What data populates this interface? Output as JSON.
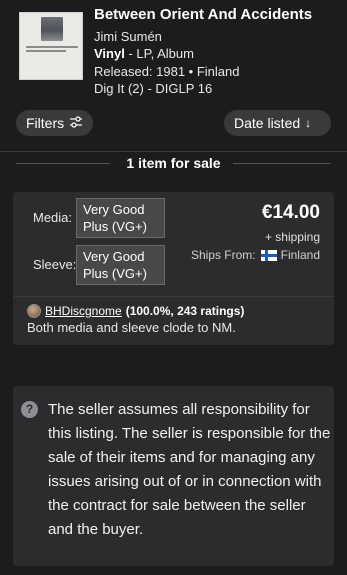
{
  "release": {
    "cover_text": "BETWEEN ORIENT AND ACCIDENTS",
    "title": "Between Orient And Accidents",
    "artist": "Jimi Sumén",
    "format_bold": "Vinyl",
    "format_rest": " - LP, Album",
    "released": "Released: 1981 • Finland",
    "label": "Dig It (2) - DIGLP 16"
  },
  "controls": {
    "filters_label": "Filters",
    "filters_icon": "sliders-icon",
    "sort_label": "Date listed",
    "sort_icon": "arrow-down-icon"
  },
  "results": {
    "count_text": "1 item for sale"
  },
  "listing": {
    "media_label": "Media:",
    "media_condition": "Very Good Plus (VG+)",
    "sleeve_label": "Sleeve:",
    "sleeve_condition": "Very Good Plus (VG+)",
    "price": "€14.00",
    "shipping": "+ shipping",
    "ships_from_label": "Ships From:",
    "ships_from_country": "Finland",
    "seller_name": "BHDiscgnome",
    "seller_rating": "(100.0%, 243 ratings)",
    "comment": "Both media and sleeve clode to NM."
  },
  "disclaimer": {
    "icon": "question-icon",
    "text": "The seller assumes all responsibility for this listing. The seller is responsible for the sale of their items and for managing any issues arising out of or in connection with the contract for sale between the seller and the buyer."
  },
  "colors": {
    "background": "#1c1c1e",
    "card": "#2c2c2e",
    "pill": "#3a3a3c",
    "condition_box": "#48484a",
    "flag_blue": "#1b5dc8"
  }
}
